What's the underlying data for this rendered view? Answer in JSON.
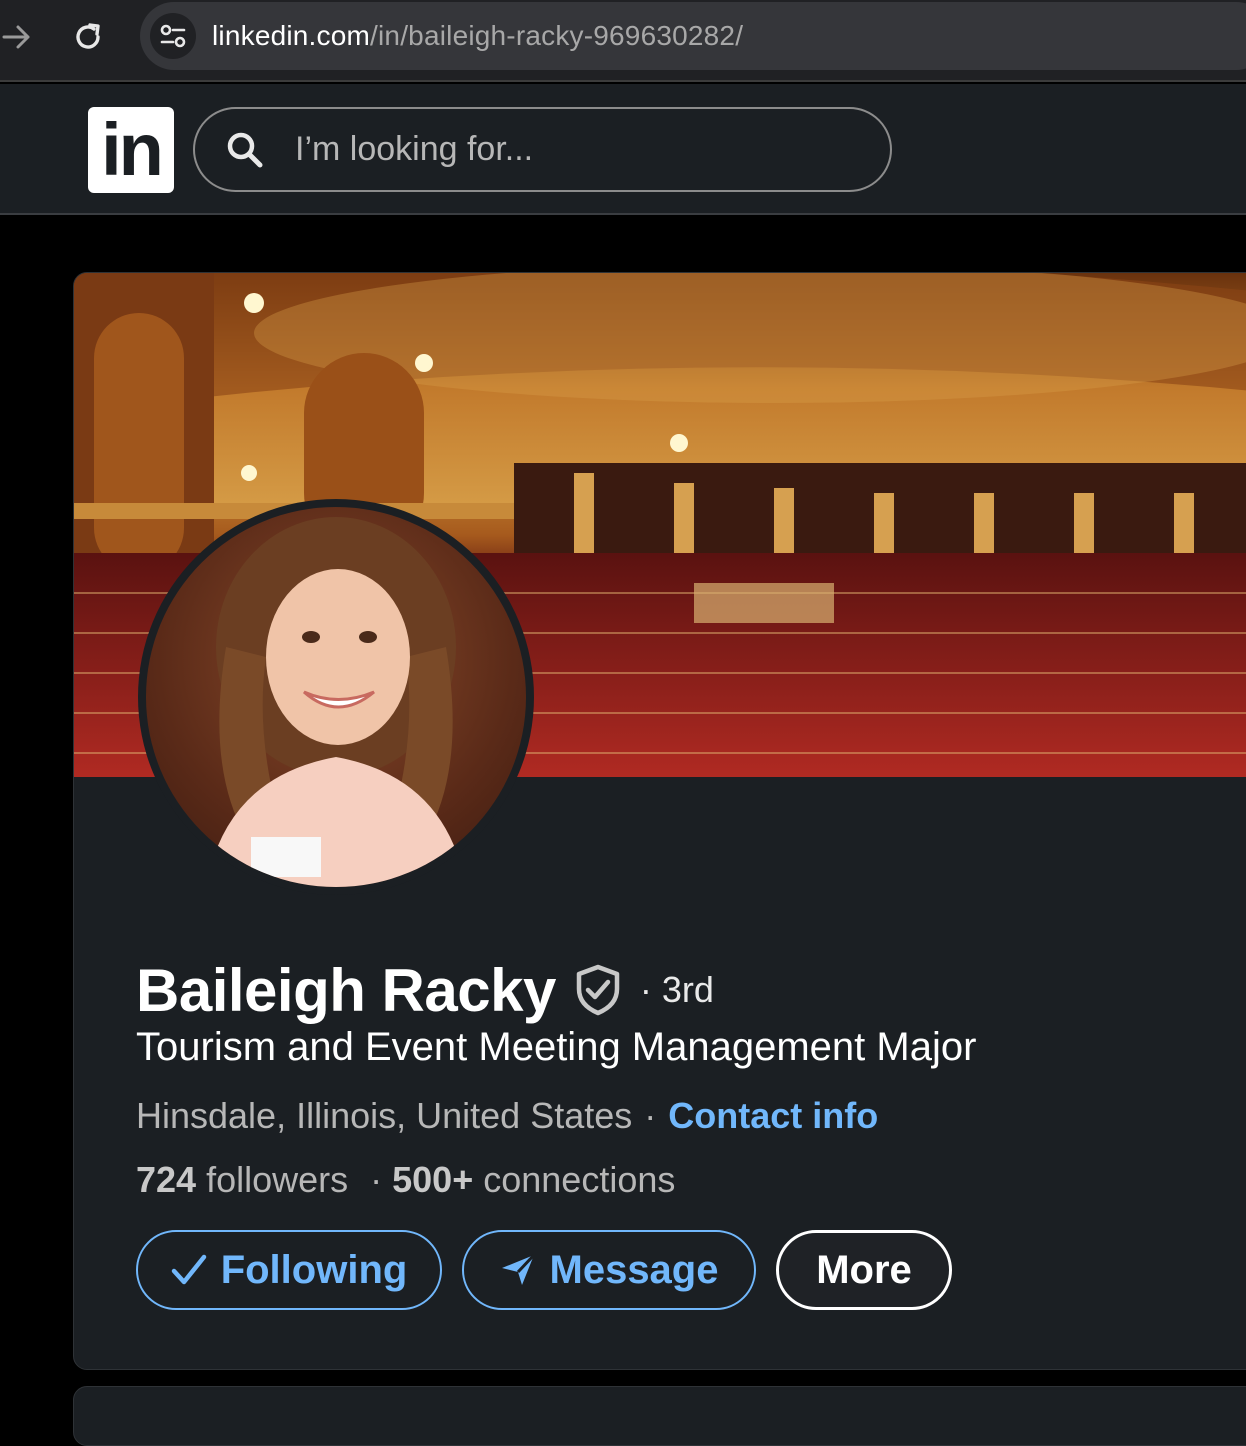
{
  "browser": {
    "url_host": "linkedin.com",
    "url_path": "/in/baileigh-racky-969630282/"
  },
  "header": {
    "logo_text": "in",
    "search_placeholder": "I’m looking for..."
  },
  "profile": {
    "name": "Baileigh Racky",
    "degree": "· 3rd",
    "headline": "Tourism and Event Meeting Management Major",
    "location": "Hinsdale, Illinois, United States",
    "location_separator": "·",
    "contact_link": "Contact info",
    "followers_count": "724",
    "followers_label": "followers",
    "stats_separator": "·",
    "connections_count": "500+",
    "connections_label": "connections"
  },
  "actions": {
    "following_label": "Following",
    "message_label": "Message",
    "more_label": "More"
  },
  "colors": {
    "accent_blue": "#71b7fb",
    "card_bg": "#1b1f23",
    "page_bg": "#000000"
  },
  "icons": {
    "forward": "arrow-right-icon",
    "reload": "reload-icon",
    "site_info": "tune-icon",
    "search": "search-icon",
    "verified": "verified-shield-icon",
    "following": "check-icon",
    "message": "send-icon"
  }
}
